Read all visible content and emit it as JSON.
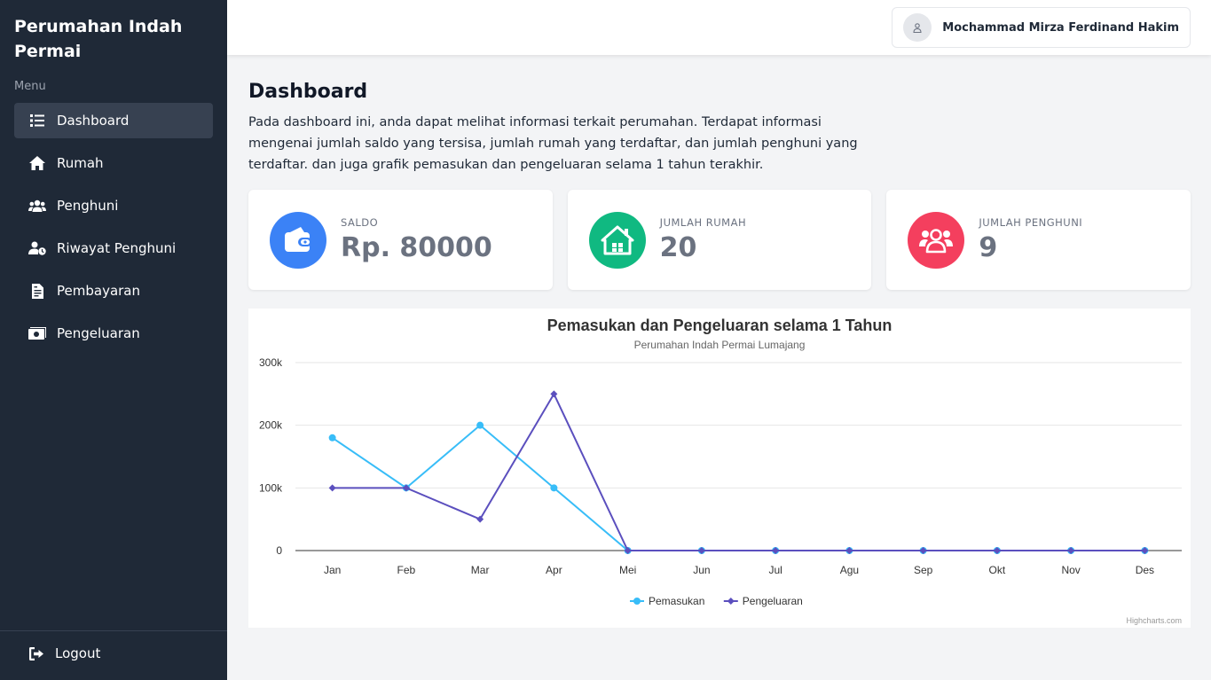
{
  "sidebar": {
    "brand": "Perumahan Indah Permai",
    "menu_heading": "Menu",
    "items": [
      {
        "label": "Dashboard",
        "icon": "list-icon",
        "active": true
      },
      {
        "label": "Rumah",
        "icon": "home-icon"
      },
      {
        "label": "Penghuni",
        "icon": "users-icon"
      },
      {
        "label": "Riwayat Penghuni",
        "icon": "user-clock-icon"
      },
      {
        "label": "Pembayaran",
        "icon": "file-invoice-icon"
      },
      {
        "label": "Pengeluaran",
        "icon": "money-bill-icon"
      }
    ],
    "logout": "Logout"
  },
  "topbar": {
    "user_name": "Mochammad Mirza Ferdinand Hakim"
  },
  "page": {
    "title": "Dashboard",
    "description": "Pada dashboard ini, anda dapat melihat informasi terkait perumahan. Terdapat informasi mengenai jumlah saldo yang tersisa, jumlah rumah yang terdaftar, dan jumlah penghuni yang terdaftar. dan juga grafik pemasukan dan pengeluaran selama 1 tahun terakhir."
  },
  "cards": [
    {
      "label": "SALDO",
      "value": "Rp. 80000",
      "icon": "wallet-icon",
      "color": "#3b82f6"
    },
    {
      "label": "JUMLAH RUMAH",
      "value": "20",
      "icon": "house-icon",
      "color": "#10b981"
    },
    {
      "label": "JUMLAH PENGHUNI",
      "value": "9",
      "icon": "users-group-icon",
      "color": "#f43f5e"
    }
  ],
  "chart_data": {
    "type": "line",
    "title": "Pemasukan dan Pengeluaran selama 1 Tahun",
    "subtitle": "Perumahan Indah Permai Lumajang",
    "categories": [
      "Jan",
      "Feb",
      "Mar",
      "Apr",
      "Mei",
      "Jun",
      "Jul",
      "Agu",
      "Sep",
      "Okt",
      "Nov",
      "Des"
    ],
    "y_ticks": [
      "0",
      "100k",
      "200k",
      "300k"
    ],
    "ylim": [
      0,
      300000
    ],
    "series": [
      {
        "name": "Pemasukan",
        "color": "#38bdf8",
        "marker": "circle",
        "values": [
          180000,
          100000,
          200000,
          100000,
          0,
          0,
          0,
          0,
          0,
          0,
          0,
          0
        ]
      },
      {
        "name": "Pengeluaran",
        "color": "#5b4fbe",
        "marker": "diamond",
        "values": [
          100000,
          100000,
          50000,
          250000,
          0,
          0,
          0,
          0,
          0,
          0,
          0,
          0
        ]
      }
    ],
    "legend": "bottom-center",
    "credits": "Highcharts.com"
  }
}
